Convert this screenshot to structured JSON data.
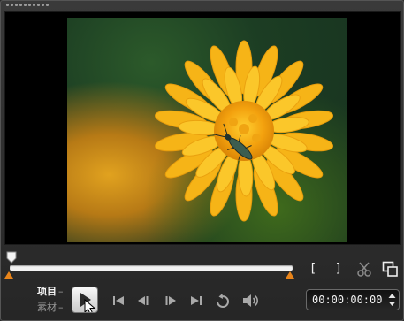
{
  "window": {
    "grip": "drag-grip"
  },
  "preview": {
    "content": "dandelion-with-beetle-photo"
  },
  "scrubber": {
    "playhead_position": 0.0,
    "trim_start": 0.0,
    "trim_end": 1.0
  },
  "mark_in": {
    "label": "["
  },
  "mark_out": {
    "label": "]"
  },
  "icons": {
    "cut": "scissors-icon",
    "enlarge": "enlarge-icon",
    "home": "skip-to-start-icon",
    "prev": "previous-frame-icon",
    "next": "next-frame-icon",
    "end": "skip-to-end-icon",
    "repeat": "repeat-icon",
    "volume": "volume-icon",
    "play": "play-icon"
  },
  "mode": {
    "project": "项目",
    "clip": "素材",
    "dash": "–",
    "selected": "project"
  },
  "timecode": {
    "value": "00:00:00:00"
  },
  "colors": {
    "trim_marker": "#e8841a",
    "track": "#f2f2f2",
    "background": "#2b2b2b"
  }
}
